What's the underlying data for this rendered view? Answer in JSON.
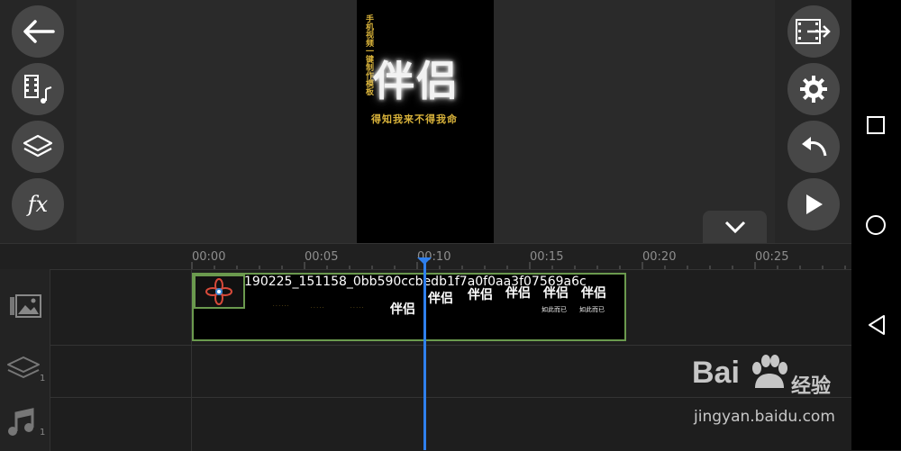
{
  "preview": {
    "title": "伴侣",
    "subtitle": "得知我来不得我命",
    "vertical_text": "手机视频一键制作模板"
  },
  "left_toolbar": {
    "icons": [
      "back-arrow-icon",
      "media-music-icon",
      "layers-icon",
      "fx-icon"
    ],
    "fx_label": "fx"
  },
  "right_toolbar": {
    "icons": [
      "export-film-icon",
      "gear-icon",
      "undo-icon",
      "play-icon"
    ]
  },
  "timeline": {
    "ticks": [
      "00:00",
      "00:05",
      "00:10",
      "00:15",
      "00:20",
      "00:25"
    ],
    "clip_name": "190225_151158_0bb590ccbedb1f7a0f0aa3f07569a6c",
    "clip_frame_titles": [
      "伴侣",
      "伴侣",
      "伴侣",
      "伴侣",
      "伴侣",
      "伴侣",
      "伴侣"
    ],
    "clip_frame_captions": [
      "如此而已",
      "如此而已"
    ],
    "layer_count": "1",
    "audio_count": "1"
  },
  "watermark": {
    "logo": "Bai",
    "logo_cn": "经验",
    "url": "jingyan.baidu.com"
  },
  "colors": {
    "accent": "#2f80ed",
    "clip_border": "#6b9a4e",
    "text_gold": "#d8b23a"
  }
}
